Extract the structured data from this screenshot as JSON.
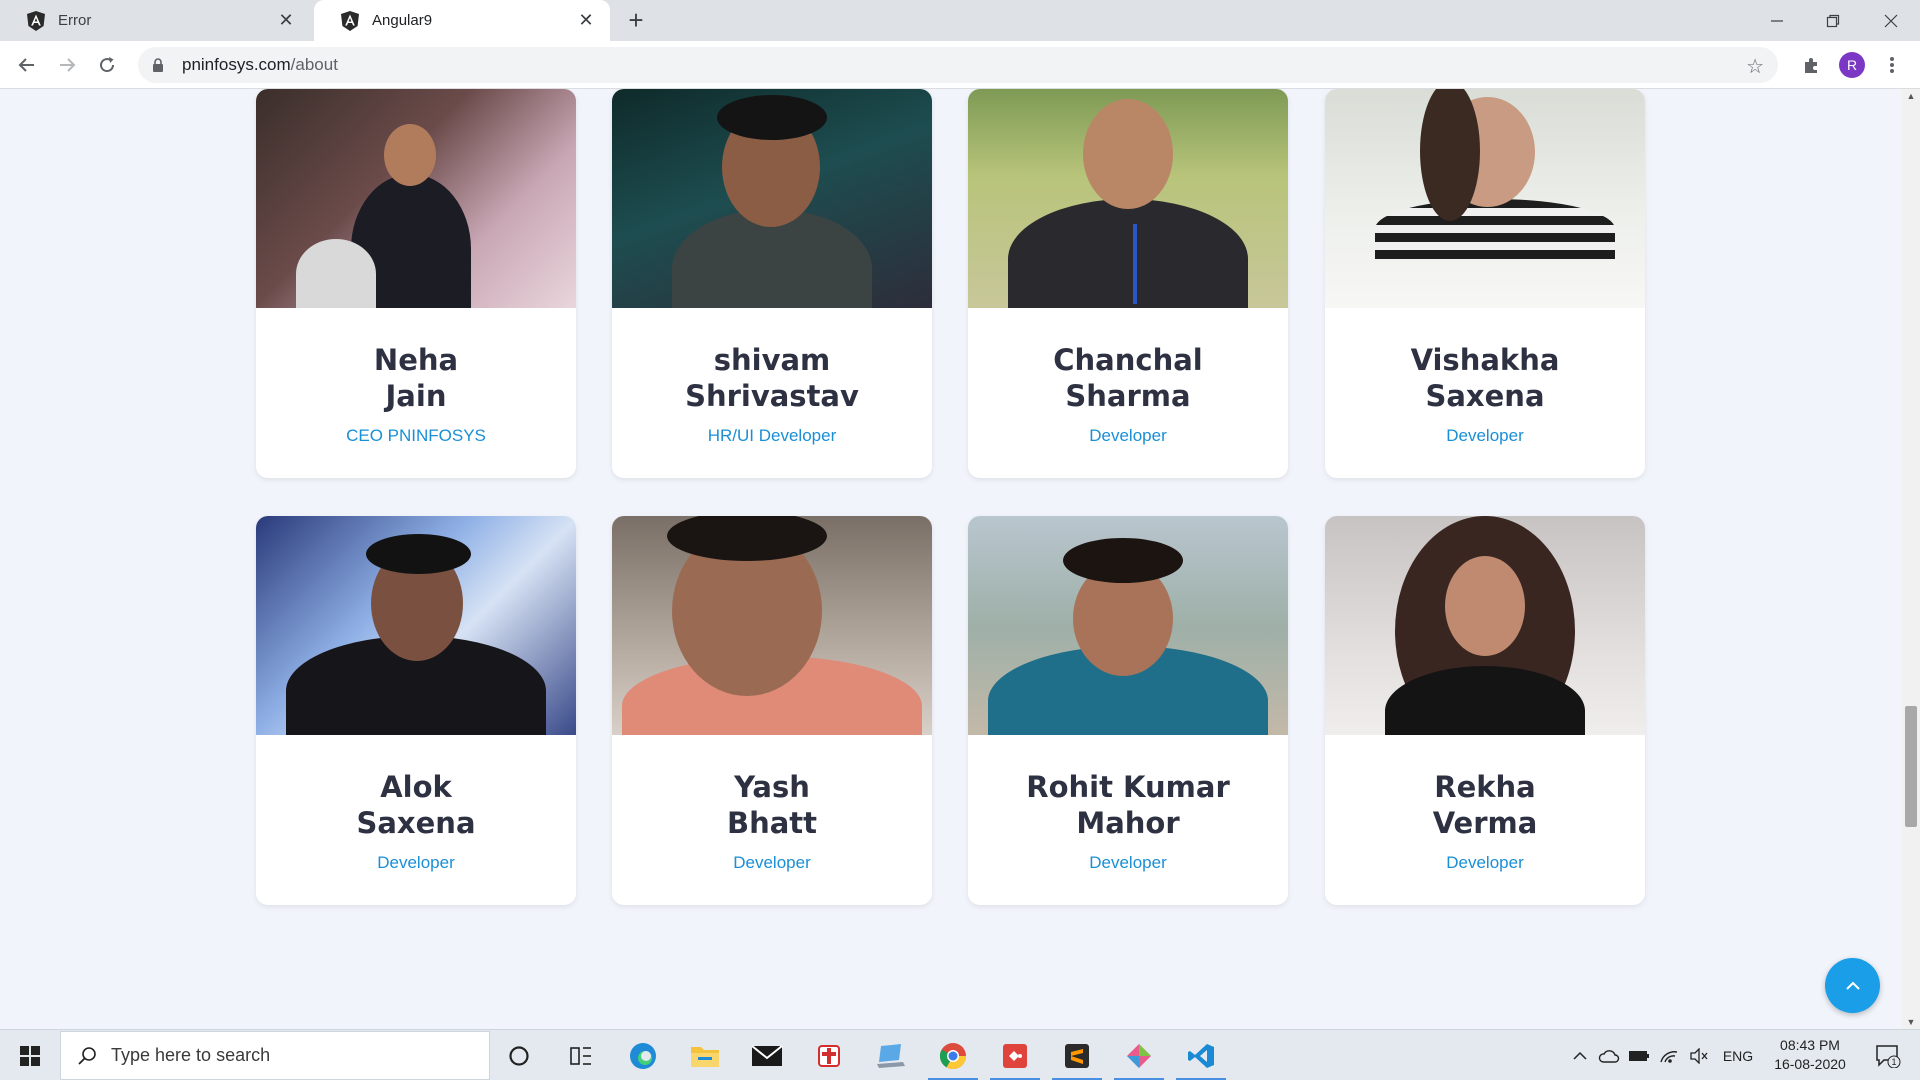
{
  "browser": {
    "tabs": [
      {
        "title": "Error",
        "active": false
      },
      {
        "title": "Angular9",
        "active": true
      }
    ],
    "address": {
      "host": "pninfosys.com",
      "path": "/about"
    },
    "profile_initial": "R"
  },
  "team": [
    {
      "first": "Neha",
      "last": "Jain",
      "role": "CEO PNINFOSYS"
    },
    {
      "first": "shivam",
      "last": "Shrivastav",
      "role": "HR/UI Developer"
    },
    {
      "first": "Chanchal",
      "last": "Sharma",
      "role": "Developer"
    },
    {
      "first": "Vishakha",
      "last": "Saxena",
      "role": "Developer"
    },
    {
      "first": "Alok",
      "last": "Saxena",
      "role": "Developer"
    },
    {
      "first": "Yash",
      "last": "Bhatt",
      "role": "Developer"
    },
    {
      "first": "Rohit Kumar",
      "last": "Mahor",
      "role": "Developer"
    },
    {
      "first": "Rekha",
      "last": "Verma",
      "role": "Developer"
    }
  ],
  "taskbar": {
    "search_placeholder": "Type here to search",
    "apps": [
      "cortana-icon",
      "task-view-icon",
      "edge-icon",
      "file-explorer-icon",
      "mail-icon",
      "gift-icon",
      "laptop-app-icon",
      "chrome-icon",
      "git-icon",
      "sublime-icon",
      "tool-icon",
      "vscode-icon"
    ],
    "language": "ENG",
    "time": "08:43 PM",
    "date": "16-08-2020",
    "notification_count": "1"
  },
  "colors": {
    "accent": "#1a8fd6",
    "page_bg": "#f1f5fb",
    "name_text": "#2d3142"
  }
}
